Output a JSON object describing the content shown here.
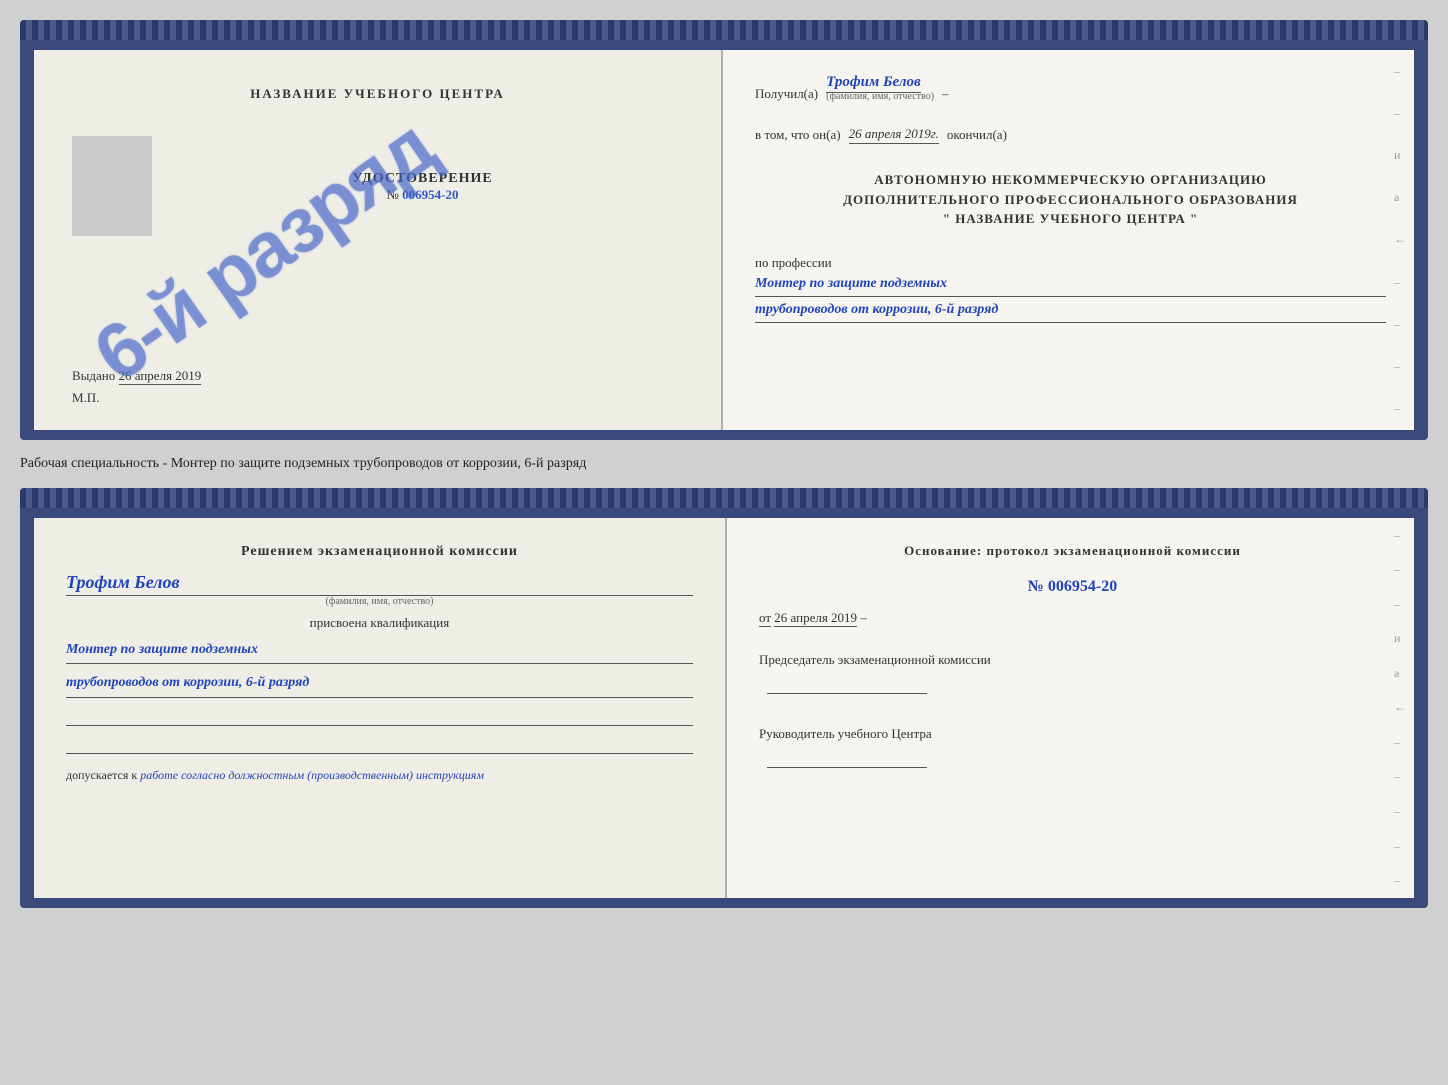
{
  "top_document": {
    "left": {
      "training_center_label": "НАЗВАНИЕ УЧЕБНОГО ЦЕНТРА",
      "cert_label": "УДОСТОВЕРЕНИЕ",
      "cert_number_prefix": "№",
      "cert_number": "006954-20",
      "issued_prefix": "Выдано",
      "issued_date": "26 апреля 2019",
      "mp_label": "М.П.",
      "stamp_text": "6-й разряд"
    },
    "right": {
      "recipient_prefix": "Получил(а)",
      "recipient_name": "Трофим Белов",
      "recipient_sub": "(фамилия, имя, отчество)",
      "date_prefix": "в том, что он(а)",
      "date_value": "26 апреля 2019г.",
      "date_suffix": "окончил(а)",
      "org_line1": "АВТОНОМНУЮ НЕКОММЕРЧЕСКУЮ ОРГАНИЗАЦИЮ",
      "org_line2": "ДОПОЛНИТЕЛЬНОГО ПРОФЕССИОНАЛЬНОГО ОБРАЗОВАНИЯ",
      "org_line3": "\"   НАЗВАНИЕ УЧЕБНОГО ЦЕНТРА   \"",
      "profession_label": "по профессии",
      "profession_line1": "Монтер по защите подземных",
      "profession_line2": "трубопроводов от коррозии, 6-й разряд"
    }
  },
  "middle_text": "Рабочая специальность - Монтер по защите подземных трубопроводов от коррозии, 6-й разряд",
  "bottom_document": {
    "left": {
      "commission_header": "Решением экзаменационной комиссии",
      "person_name": "Трофим Белов",
      "person_sub": "(фамилия, имя, отчество)",
      "qualification_label": "присвоена квалификация",
      "qualification_line1": "Монтер по защите подземных",
      "qualification_line2": "трубопроводов от коррозии, 6-й разряд",
      "допускается_prefix": "допускается к",
      "допускается_value": "работе согласно должностным (производственным) инструкциям"
    },
    "right": {
      "osnov_header": "Основание: протокол экзаменационной комиссии",
      "protocol_number": "№ 006954-20",
      "protocol_date_prefix": "от",
      "protocol_date": "26 апреля 2019",
      "chairman_label": "Председатель экзаменационной комиссии",
      "director_label": "Руководитель учебного Центра"
    }
  }
}
